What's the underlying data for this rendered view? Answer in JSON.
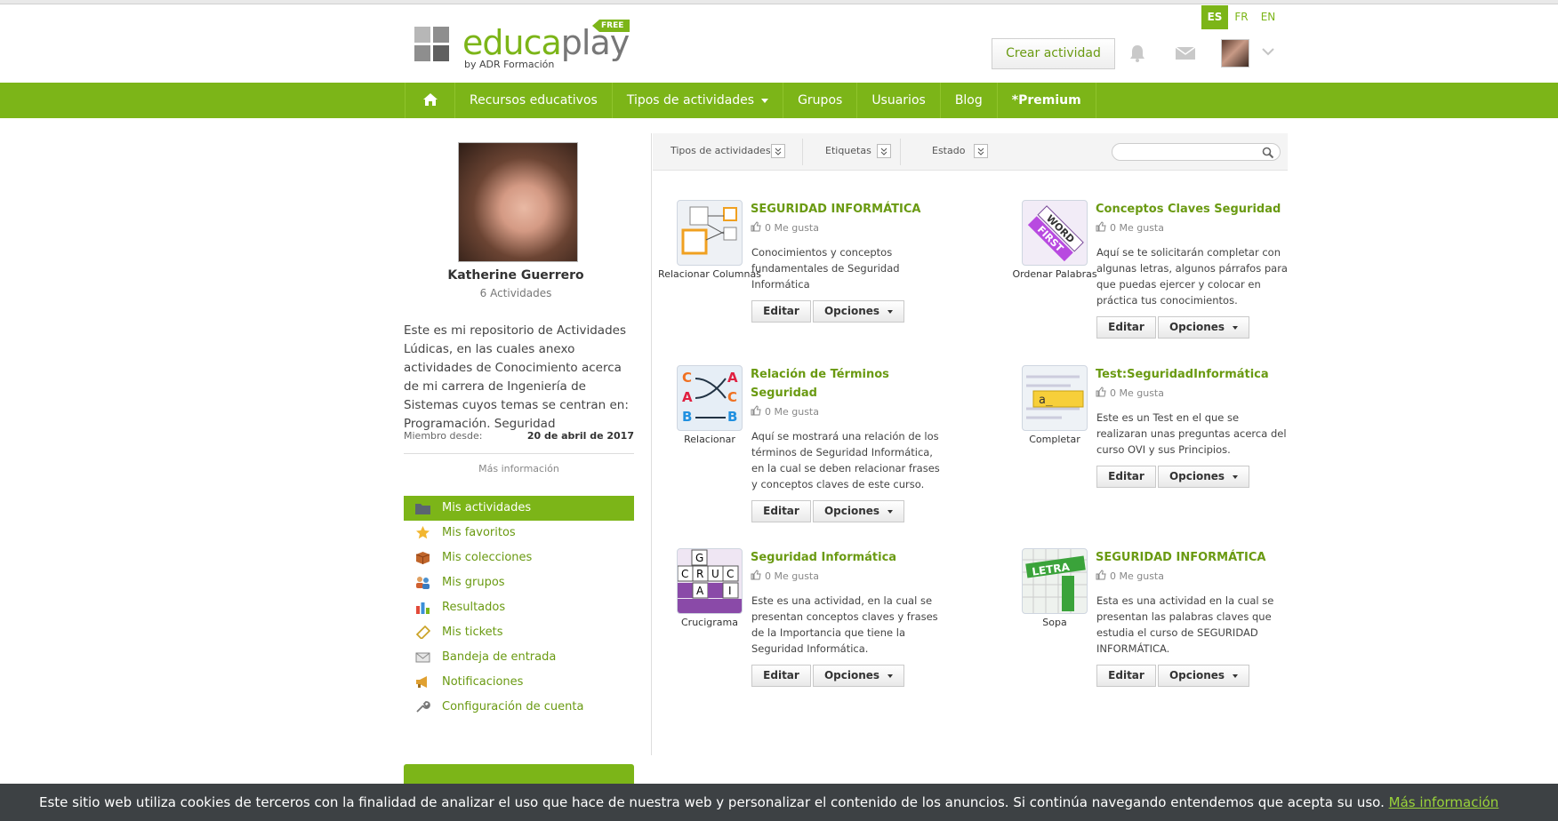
{
  "brand": {
    "name_green": "educa",
    "name_gray": "play",
    "sub": "by ADR Formación",
    "badge": "FREE"
  },
  "languages": [
    {
      "code": "ES",
      "active": true
    },
    {
      "code": "FR",
      "active": false
    },
    {
      "code": "EN",
      "active": false
    }
  ],
  "header": {
    "create_label": "Crear actividad"
  },
  "nav": {
    "home_icon": "home-icon",
    "items": [
      "Recursos educativos",
      "Tipos de actividades",
      "Grupos",
      "Usuarios",
      "Blog"
    ],
    "premium": "Premium"
  },
  "profile": {
    "name": "Katherine Guerrero",
    "count": "6 Actividades",
    "bio": "Este es mi repositorio de Actividades Lúdicas, en las cuales anexo actividades de Conocimiento acerca de mi carrera de Ingeniería de Sistemas cuyos temas se centran en: Programación. Seguridad",
    "member_label": "Miembro desde:",
    "member_date": "20 de abril de 2017",
    "more_info": "Más información"
  },
  "menu": [
    {
      "label": "Mis actividades",
      "icon": "folder-icon",
      "active": true
    },
    {
      "label": "Mis favoritos",
      "icon": "star-icon",
      "active": false
    },
    {
      "label": "Mis colecciones",
      "icon": "box-icon",
      "active": false
    },
    {
      "label": "Mis grupos",
      "icon": "group-icon",
      "active": false
    },
    {
      "label": "Resultados",
      "icon": "bar-chart-icon",
      "active": false
    },
    {
      "label": "Mis tickets",
      "icon": "ticket-icon",
      "active": false
    },
    {
      "label": "Bandeja de entrada",
      "icon": "envelope-icon",
      "active": false
    },
    {
      "label": "Notificaciones",
      "icon": "megaphone-icon",
      "active": false
    },
    {
      "label": "Configuración de cuenta",
      "icon": "wrench-icon",
      "active": false
    }
  ],
  "filters": {
    "types": "Tipos de actividades",
    "tags": "Etiquetas",
    "state": "Estado",
    "search_placeholder": ""
  },
  "activities": [
    {
      "title": "SEGURIDAD INFORMÁTICA",
      "type": "Relacionar Columnas",
      "likes": "0 Me gusta",
      "desc": "Conocimientos y conceptos fundamentales de Seguridad Informática",
      "edit": "Editar",
      "options": "Opciones"
    },
    {
      "title": "Conceptos Claves Seguridad",
      "type": "Ordenar Palabras",
      "likes": "0 Me gusta",
      "desc": "Aquí se te solicitarán completar con algunas letras, algunos párrafos para que puedas ejercer y colocar en práctica tus conocimientos.",
      "edit": "Editar",
      "options": "Opciones"
    },
    {
      "title": "Relación de Términos Seguridad",
      "type": "Relacionar",
      "likes": "0 Me gusta",
      "desc": "Aquí se mostrará una relación de los términos de Seguridad Informática, en la cual se deben relacionar frases y conceptos claves de este curso.",
      "edit": "Editar",
      "options": "Opciones"
    },
    {
      "title": "Test:SeguridadInformática",
      "type": "Completar",
      "likes": "0 Me gusta",
      "desc": "Este es un Test en el que se realizaran unas preguntas acerca del curso OVI y sus Principios.",
      "edit": "Editar",
      "options": "Opciones"
    },
    {
      "title": "Seguridad Informática",
      "type": "Crucigrama",
      "likes": "0 Me gusta",
      "desc": "Este es una actividad, en la cual se presentan conceptos claves y frases de la Importancia que tiene la Seguridad Informática.",
      "edit": "Editar",
      "options": "Opciones"
    },
    {
      "title": "SEGURIDAD INFORMÁTICA",
      "type": "Sopa",
      "likes": "0 Me gusta",
      "desc": "Esta es una actividad en la cual se presentan las palabras claves que estudia el curso de SEGURIDAD INFORMÁTICA.",
      "edit": "Editar",
      "options": "Opciones"
    }
  ],
  "thumb_text": {
    "word": "WORD",
    "first": "FIRST",
    "completar": "a_",
    "rel_left": [
      "C",
      "A",
      "B"
    ],
    "rel_right": [
      "A",
      "C",
      "B"
    ],
    "cross": [
      "G",
      "C",
      "R",
      "U",
      "C",
      "A",
      "I"
    ],
    "sopa": "LETRA"
  },
  "cookie": {
    "text": "Este sitio web utiliza cookies de terceros con la finalidad de analizar el uso que hace de nuestra web y personalizar el contenido de los anuncios. Si continúa navegando entendemos que acepta su uso.",
    "link": "Más información"
  },
  "colors": {
    "brand": "#7cb518",
    "link": "#6a9a12",
    "cookie_bg": "#3d4144"
  }
}
